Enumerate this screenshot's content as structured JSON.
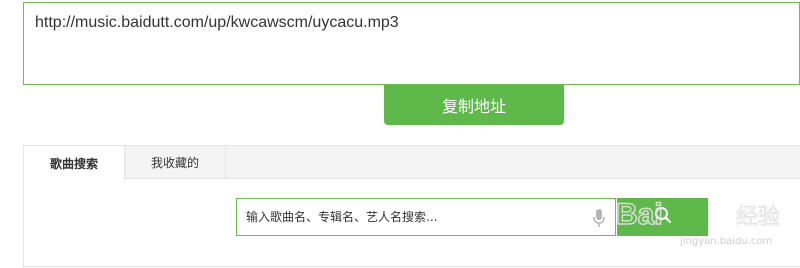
{
  "url_box": {
    "value": "http://music.baidutt.com/up/kwcawscm/uycacu.mp3"
  },
  "copy_button": {
    "label": "复制地址"
  },
  "tabs": [
    {
      "label": "歌曲搜索",
      "active": true
    },
    {
      "label": "我收藏的",
      "active": false
    }
  ],
  "search": {
    "placeholder": "输入歌曲名、专辑名、艺人名搜索...",
    "mic_icon": "microphone-icon",
    "button_icon": "search-icon"
  },
  "watermark": {
    "brand": "Bai 经验",
    "url": "jingyan.baidu.com"
  },
  "colors": {
    "accent": "#5eb94a",
    "border_green": "#6ebf4b",
    "tab_bg": "#f4f4f4"
  }
}
